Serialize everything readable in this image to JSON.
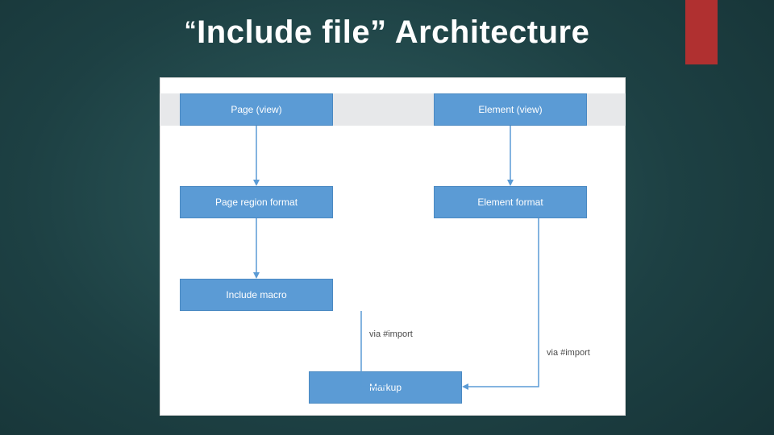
{
  "title": {
    "quote1": "“",
    "main": "Include file” Architecture"
  },
  "colors": {
    "accent": "#b03030",
    "bg_center": "#2f5d5f",
    "box": "#5b9bd5"
  },
  "diagram": {
    "nodes": {
      "page_view": "Page (view)",
      "element_view": "Element (view)",
      "page_region_format": "Page region format",
      "element_format": "Element format",
      "include_macro": "Include macro",
      "markup": "Markup"
    },
    "edge_labels": {
      "via_import_left": "via #import",
      "via_import_right": "via #import"
    },
    "edges": [
      {
        "from": "page_view",
        "to": "page_region_format"
      },
      {
        "from": "page_region_format",
        "to": "include_macro"
      },
      {
        "from": "include_macro",
        "to": "markup",
        "label": "via #import"
      },
      {
        "from": "element_view",
        "to": "element_format"
      },
      {
        "from": "element_format",
        "to": "markup",
        "label": "via #import"
      }
    ]
  }
}
